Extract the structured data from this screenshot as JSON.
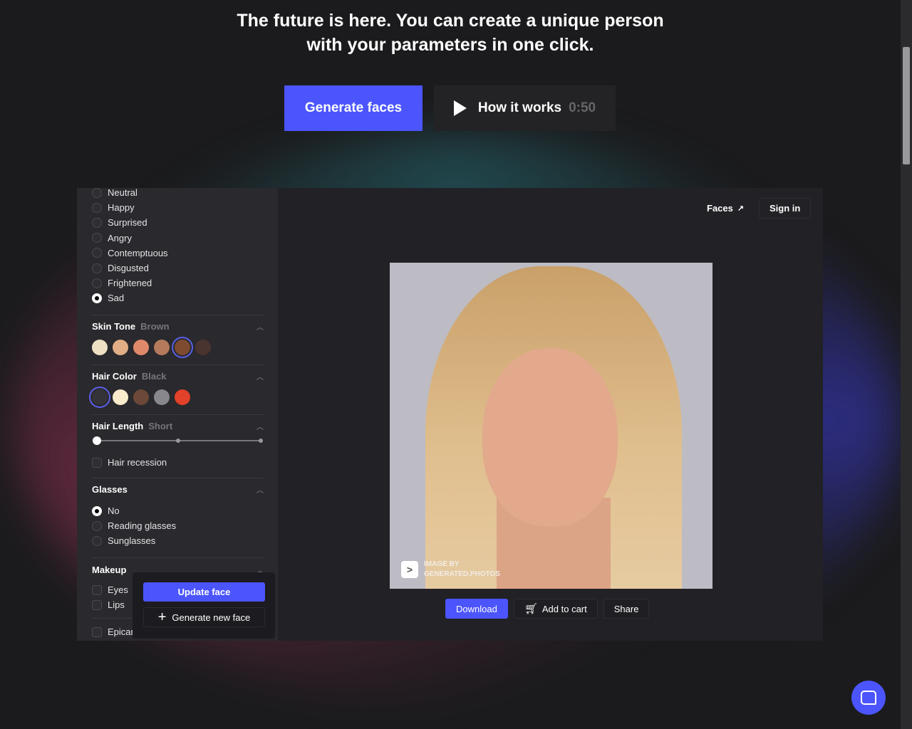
{
  "hero": {
    "line1": "The future is here. You can create a unique person",
    "line2": "with your parameters in one click."
  },
  "buttons": {
    "generate": "Generate faces",
    "how": "How it works",
    "how_duration": "0:50"
  },
  "sidebar": {
    "emotions": [
      {
        "label": "Neutral",
        "selected": false
      },
      {
        "label": "Happy",
        "selected": false
      },
      {
        "label": "Surprised",
        "selected": false
      },
      {
        "label": "Angry",
        "selected": false
      },
      {
        "label": "Contemptuous",
        "selected": false
      },
      {
        "label": "Disgusted",
        "selected": false
      },
      {
        "label": "Frightened",
        "selected": false
      },
      {
        "label": "Sad",
        "selected": true
      }
    ],
    "skin_tone": {
      "title": "Skin Tone",
      "value": "Brown",
      "colors": [
        "#efe0c4",
        "#e1ae86",
        "#de8a6a",
        "#b37a5c",
        "#7e4b31",
        "#4a3430"
      ],
      "selected_index": 4
    },
    "hair_color": {
      "title": "Hair Color",
      "value": "Black",
      "colors": [
        "#343338",
        "#f9ebcb",
        "#6b4838",
        "#88888c",
        "#e2412a"
      ],
      "selected_index": 0
    },
    "hair_length": {
      "title": "Hair Length",
      "value": "Short",
      "level": 0
    },
    "hair_recession": "Hair recession",
    "glasses": {
      "title": "Glasses",
      "options": [
        {
          "label": "No",
          "selected": true
        },
        {
          "label": "Reading glasses",
          "selected": false
        },
        {
          "label": "Sunglasses",
          "selected": false
        }
      ]
    },
    "makeup": {
      "title": "Makeup",
      "options": [
        "Eyes",
        "Lips"
      ]
    },
    "epicanthus": "Epicar"
  },
  "popup": {
    "update": "Update face",
    "new": "Generate new face"
  },
  "topbar": {
    "faces": "Faces",
    "signin": "Sign in"
  },
  "watermark": {
    "line1": "IMAGE BY",
    "line2": "GENERATED.PHOTOS"
  },
  "actions": {
    "download": "Download",
    "cart": "Add to cart",
    "share": "Share"
  },
  "accent": "#4b55fb"
}
